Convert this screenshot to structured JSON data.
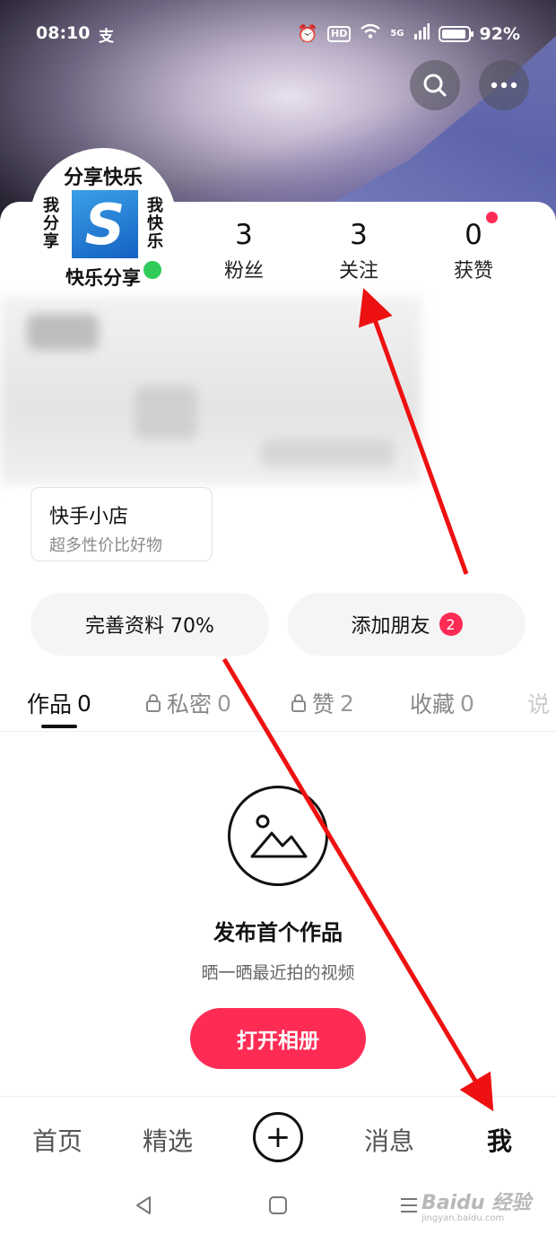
{
  "status_bar": {
    "time": "08:10",
    "app_glyph": "支",
    "hd_badge": "HD",
    "network_badge": "5G",
    "battery": "92%"
  },
  "stats": [
    {
      "value": "3",
      "label": "粉丝"
    },
    {
      "value": "3",
      "label": "关注"
    },
    {
      "value": "0",
      "label": "获赞"
    }
  ],
  "avatar": {
    "top_text": "分享快乐",
    "bottom_text": "快乐分享",
    "left_text": "我分享",
    "right_text": "我快乐",
    "logo_letter": "S"
  },
  "shop": {
    "title": "快手小店",
    "subtitle": "超多性价比好物"
  },
  "actions": {
    "complete_profile": "完善资料 70%",
    "add_friend": "添加朋友",
    "add_friend_badge": "2"
  },
  "tabs": [
    {
      "label": "作品",
      "count": "0"
    },
    {
      "label": "私密",
      "count": "0"
    },
    {
      "label": "赞",
      "count": "2"
    },
    {
      "label": "收藏",
      "count": "0"
    },
    {
      "label": "说",
      "count": ""
    }
  ],
  "empty_state": {
    "title": "发布首个作品",
    "subtitle": "晒一晒最近拍的视频",
    "button": "打开相册"
  },
  "bottom_nav": {
    "home": "首页",
    "featured": "精选",
    "create": "+",
    "messages": "消息",
    "me": "我"
  },
  "watermark": {
    "brand": "Baidu 经验",
    "url": "jingyan.baidu.com"
  },
  "colors": {
    "accent": "#fe2c55",
    "online": "#2fcc5a",
    "annotation_arrow": "#ee1111"
  }
}
